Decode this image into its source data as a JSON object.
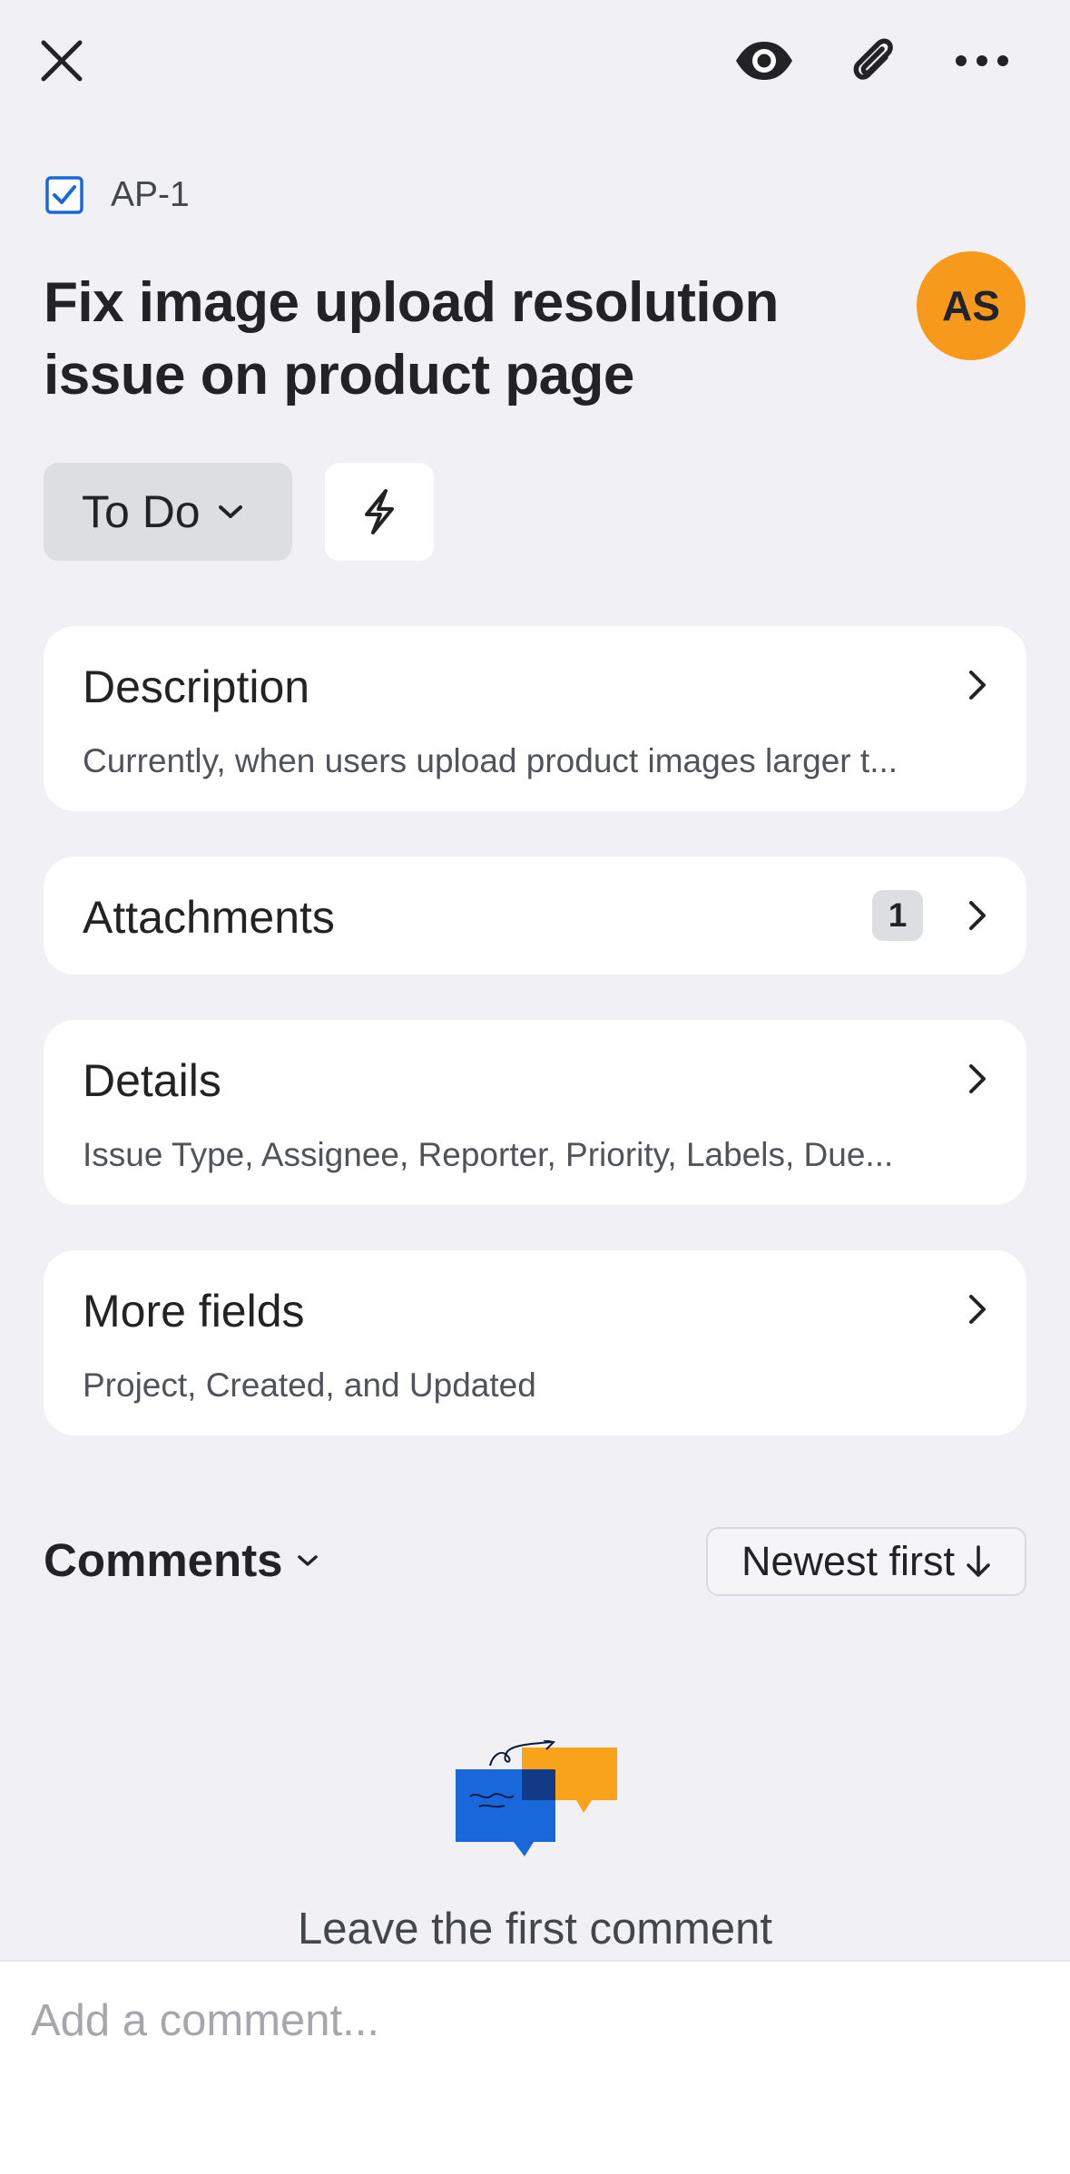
{
  "header": {
    "close_icon": "close-icon",
    "watch_icon": "eye-icon",
    "attach_icon": "paperclip-icon",
    "more_icon": "more-horizontal-icon"
  },
  "issue": {
    "type_icon": "checkbox-task-icon",
    "key": "AP-1",
    "title": "Fix image upload resolution issue on product page",
    "assignee_initials": "AS",
    "assignee_color": "#f79a1c",
    "status": "To Do",
    "quick_action_icon": "lightning-bolt-icon"
  },
  "sections": {
    "description": {
      "title": "Description",
      "preview": "Currently, when users upload product images larger t..."
    },
    "attachments": {
      "title": "Attachments",
      "count": "1"
    },
    "details": {
      "title": "Details",
      "preview": "Issue Type, Assignee, Reporter, Priority, Labels, Due..."
    },
    "more_fields": {
      "title": "More fields",
      "preview": "Project, Created, and Updated"
    }
  },
  "comments": {
    "label": "Comments",
    "sort_label": "Newest first",
    "empty_text": "Leave the first comment",
    "input_placeholder": "Add a comment..."
  },
  "colors": {
    "background": "#f1f1f5",
    "card": "#ffffff",
    "accent_blue": "#1868db",
    "accent_orange": "#f9a31a"
  }
}
